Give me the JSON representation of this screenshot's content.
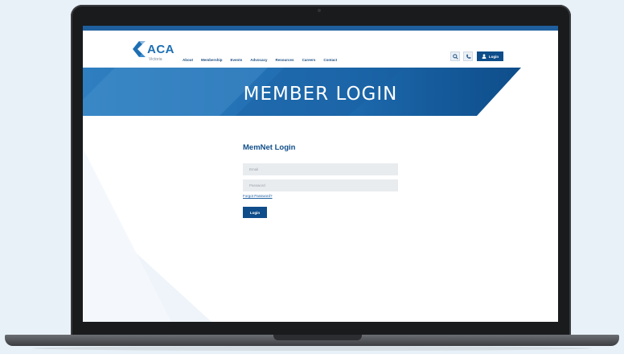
{
  "site": {
    "logo": {
      "text": "ACA",
      "subtext": "Victoria"
    },
    "nav": [
      "About",
      "Membership",
      "Events",
      "Advocacy",
      "Resources",
      "Careers",
      "Contact"
    ],
    "header_buttons": {
      "search_icon": "search-icon",
      "phone_icon": "phone-icon",
      "login_label": "Login",
      "login_icon": "user-icon"
    },
    "banner": {
      "title": "MEMBER LOGIN"
    },
    "login_form": {
      "title": "MemNet Login",
      "email_placeholder": "Email",
      "password_placeholder": "Password",
      "forgot_link": "Forgot Password?",
      "submit_label": "Login"
    },
    "colors": {
      "brand_dark": "#0e4d8a",
      "brand": "#1d6fb3",
      "banner_light": "#2f7fc0"
    }
  }
}
